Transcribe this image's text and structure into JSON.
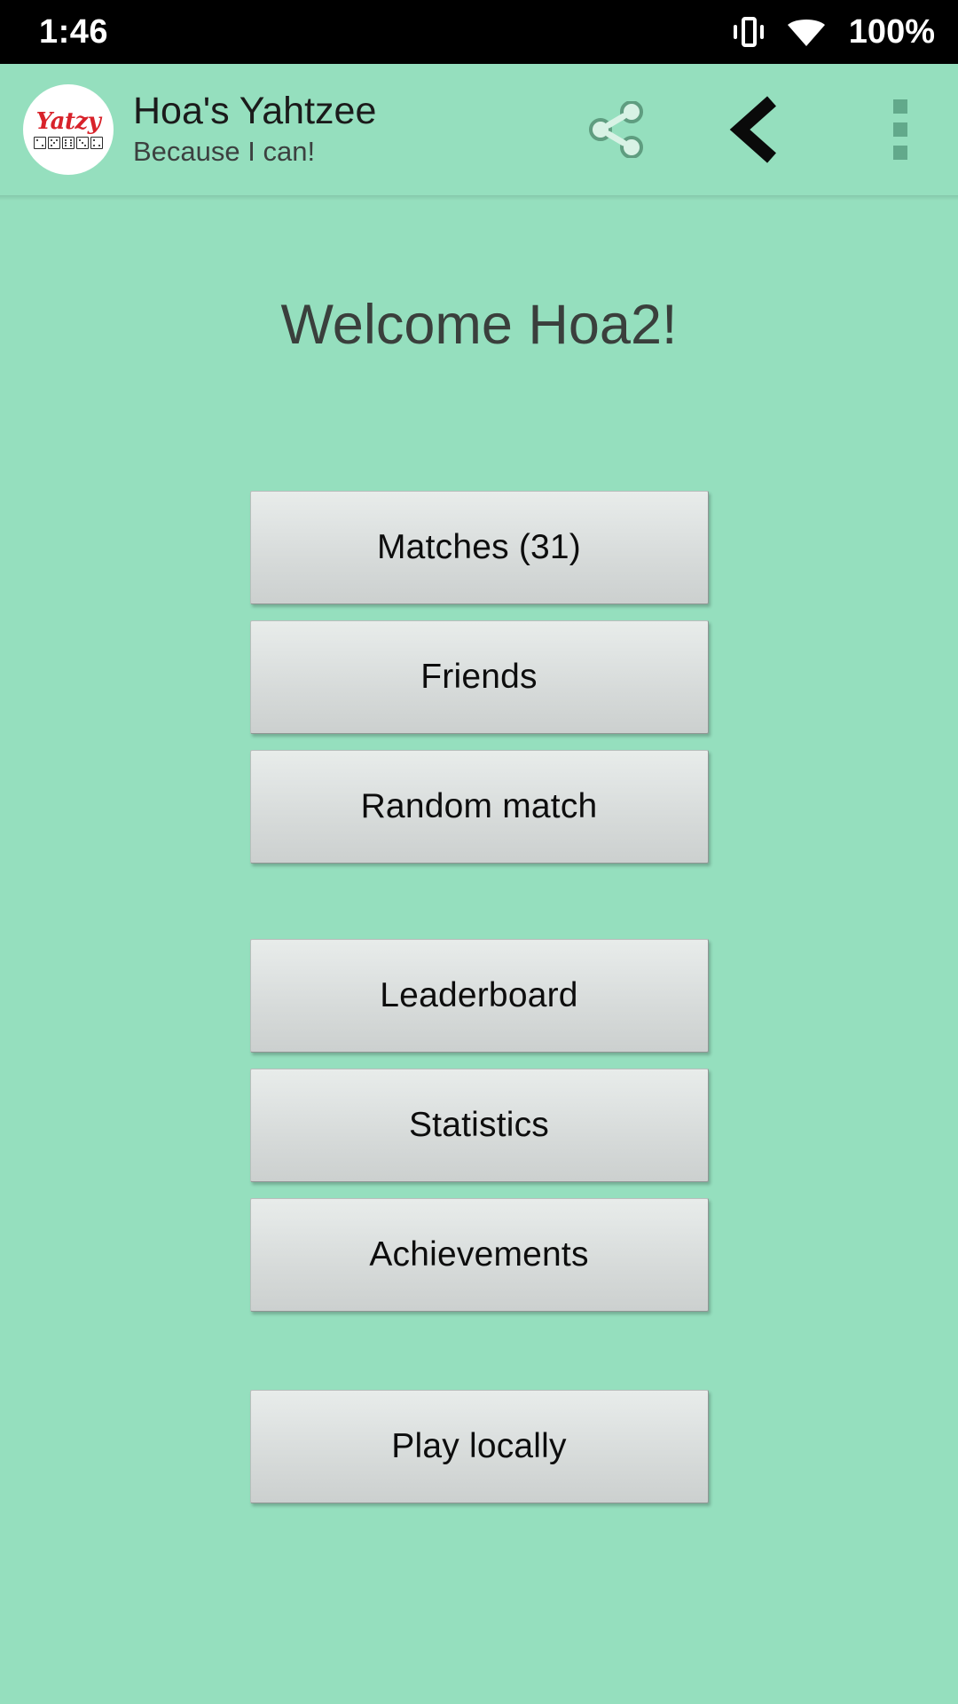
{
  "status_bar": {
    "time": "1:46",
    "battery": "100%",
    "icons": [
      "vibrate-icon",
      "wifi-icon"
    ]
  },
  "app_bar": {
    "logo": {
      "word": "Yatzy",
      "dice_count": 5
    },
    "title": "Hoa's Yahtzee",
    "subtitle": "Because I can!",
    "actions": {
      "share": "share-icon",
      "back": "back-icon",
      "overflow": "overflow-menu-icon"
    }
  },
  "main": {
    "welcome": "Welcome Hoa2!",
    "groups": [
      {
        "buttons": [
          "Matches (31)",
          "Friends",
          "Random match"
        ]
      },
      {
        "buttons": [
          "Leaderboard",
          "Statistics",
          "Achievements"
        ]
      },
      {
        "buttons": [
          "Play locally"
        ]
      }
    ]
  },
  "colors": {
    "background": "#95dfbe",
    "app_bar": "#95dfbe",
    "status_bar": "#000000",
    "logo_text": "#d8222a",
    "title_text": "#1b1b1b",
    "welcome_text": "#3a3f3c",
    "button_text": "#0d0d0d",
    "overflow_dots": "#62a98b"
  }
}
